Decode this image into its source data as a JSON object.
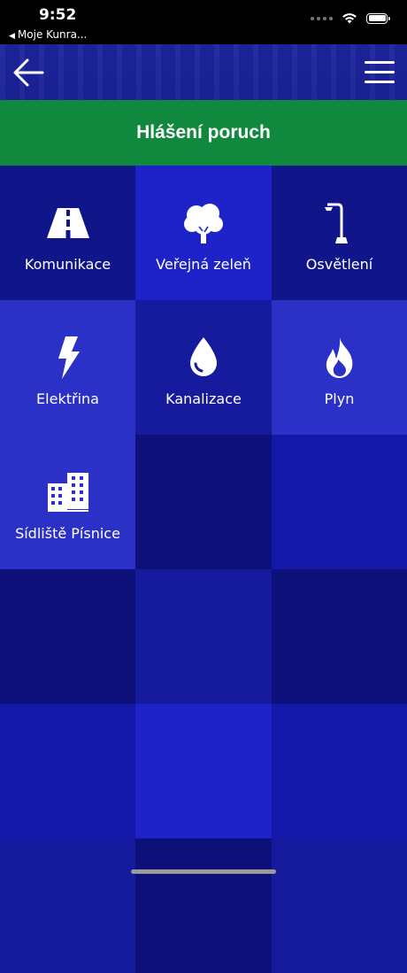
{
  "status_bar": {
    "time": "9:52",
    "back_app": "Moje Kunra..."
  },
  "navbar": {
    "back_icon": "arrow-left-icon",
    "menu_icon": "hamburger-menu-icon"
  },
  "title": "Hlášení poruch",
  "colors": {
    "title_bar": "#10883d",
    "background": "#0f1490"
  },
  "categories": [
    {
      "label": "Komunikace",
      "icon": "road-icon"
    },
    {
      "label": "Veřejná zeleň",
      "icon": "tree-icon"
    },
    {
      "label": "Osvětlení",
      "icon": "street-lamp-icon"
    },
    {
      "label": "Elektřina",
      "icon": "lightning-icon"
    },
    {
      "label": "Kanalizace",
      "icon": "water-drop-icon"
    },
    {
      "label": "Plyn",
      "icon": "flame-icon"
    },
    {
      "label": "Sídliště Písnice",
      "icon": "buildings-icon"
    }
  ]
}
